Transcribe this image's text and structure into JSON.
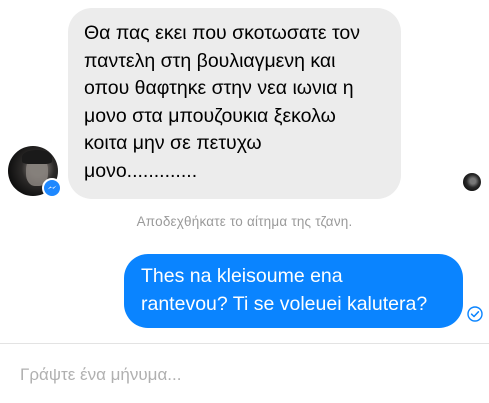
{
  "conversation": {
    "incoming_message": "Θα πας εκει που σκοτωσατε τον\nπαντελη στη βουλιαγμενη και\nοπου θαφτηκε στην νεα ιωνια η\nμονο στα μπουζουκια ξεκολω\nκοιτα μην σε πετυχω\nμονο.............",
    "system_notice": "Αποδεχθήκατε το αίτημα της τζανη.",
    "outgoing_message": "Thes na kleisoume ena\nrantevou? Ti se voleuei kalutera?"
  },
  "composer": {
    "placeholder": "Γράψτε ένα μήνυμα..."
  },
  "colors": {
    "incoming_bubble": "#ececec",
    "outgoing_bubble": "#0a84ff",
    "messenger_badge": "#1e88ff",
    "system_text": "#9a9a9a"
  },
  "icons": {
    "sender_badge": "messenger-icon",
    "status": "delivered-check-icon"
  }
}
